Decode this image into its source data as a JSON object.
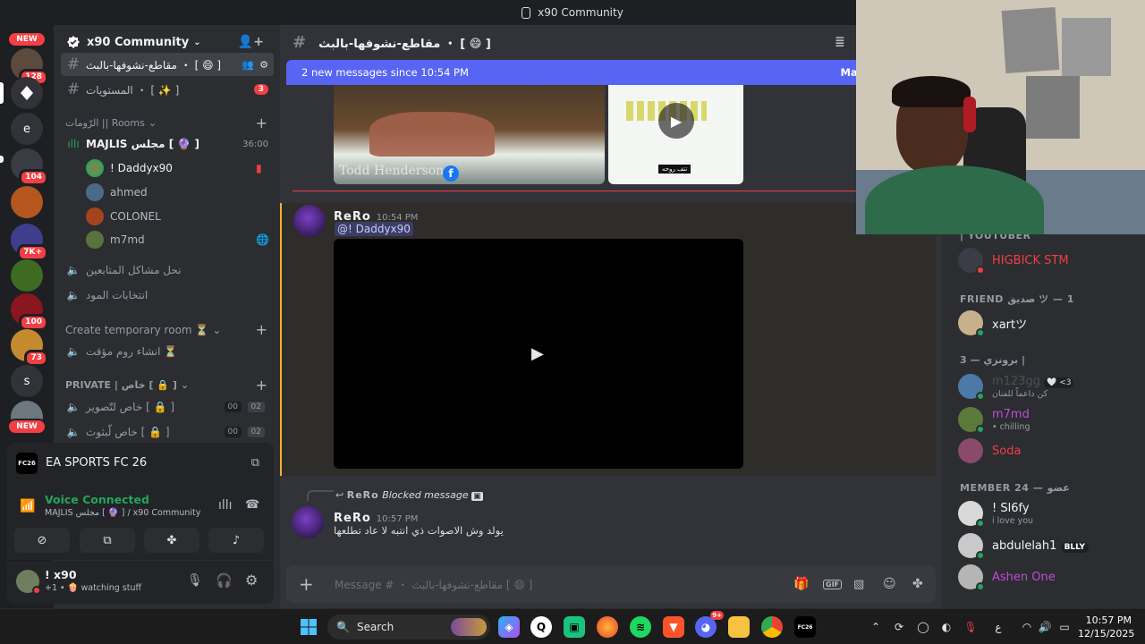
{
  "window": {
    "title": "x90 Community"
  },
  "rail": {
    "badges": [
      "NEW",
      "128",
      "104",
      "7K+",
      "100",
      "73",
      "NEW"
    ],
    "letters": [
      "e",
      "s"
    ]
  },
  "server": {
    "name": "x90 Community"
  },
  "channels": {
    "top1": "مقاطع-نشوفها-بالبث ・ [ 😄 ]",
    "top2": "المستويات ・ [ ✨ ]",
    "top2_badge": "3",
    "rooms_cat": "الرّومات || Rooms",
    "majlis": "MAJLIS مجلس [ 🔮 ]",
    "majlis_time": "36:00",
    "voice_users": [
      "! Daddyx90",
      "ahmed",
      "COLONEL",
      "m7md"
    ],
    "voice2": "نحل مشاكل المتابعين",
    "voice3": "انتخابات المود",
    "temp_cat": "Create temporary room ⏳",
    "temp_ch": "انشاء روم مؤقت ⏳",
    "private_cat": "PRIVATE | خاص [ 🔒 ]",
    "priv1": "خاص لتّصوير [ 🔒 ]",
    "priv2": "خاص لّبثوث [ 🔒 ]",
    "priv1_count": [
      "00",
      "02"
    ],
    "priv2_count": [
      "00",
      "02"
    ]
  },
  "game": {
    "name": "EA SPORTS FC 26"
  },
  "voice": {
    "status": "Voice Connected",
    "location": "MAJLIS مجلس [ 🔮 ] / x90 Community"
  },
  "user": {
    "name": "! x90",
    "status": "+1 • 🍿 watching stuff"
  },
  "main": {
    "channel_title": "مقاطع-نشوفها-بالبث ・ [ 😄 ]",
    "new_messages": "2 new messages since 10:54 PM",
    "mark": "Mark",
    "image_caption": "Todd Henderson",
    "thumb_label": "تتف روحه",
    "msg1": {
      "author": "ReRo",
      "time": "10:54 PM",
      "mention": "@! Daddyx90"
    },
    "reply": {
      "author": "ReRo",
      "text": "Blocked message"
    },
    "msg2": {
      "author": "ReRo",
      "time": "10:57 PM",
      "text": "يولد وش الاصوات ذي انتبه لا عاد تطلعها"
    },
    "composer_placeholder": "Message # ・ مقاطع-نشوفها-بالبث [ 😄 ]"
  },
  "members": {
    "cat_youtuber": "| YOUTUBER",
    "youtuber1": "HIGBICK STM",
    "cat_friend": "FRIEND صديق ツ — 1",
    "friend1": "xartツ",
    "cat_3": "برونزي — 3 |",
    "m3a": "m123gg",
    "m3a_badge": "🤍 <3",
    "m3a_sub": "كن داعماً للفنان",
    "m3b": "m7md",
    "m3b_sub": "• chilling",
    "m3c": "Soda",
    "cat_member": "MEMBER 24 — عضو",
    "mem1": "! Sl6fy",
    "mem1_sub": "i love you",
    "mem2": "abdulelah1",
    "mem2_badge": "BLLY",
    "mem3": "Ashen One"
  },
  "taskbar": {
    "search": "Search",
    "time": "10:57 PM",
    "date": "12/15/2025",
    "lang": "ع",
    "discord_badge": "9+"
  },
  "colors": {
    "accent": "#5865f2",
    "red": "#f23f43",
    "green": "#23a55a",
    "bg": "#313338"
  }
}
